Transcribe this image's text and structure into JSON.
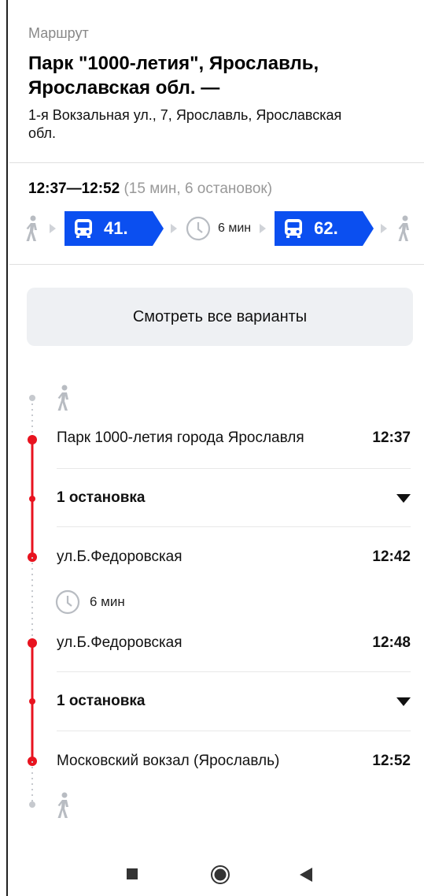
{
  "header": {
    "overline": "Маршрут",
    "title_line1": "Парк \"1000-летия\", Ярославль,",
    "title_line2": "Ярославская обл. —",
    "subtitle_line1": "1-я Вокзальная ул., 7, Ярославль, Ярославская",
    "subtitle_line2": "обл."
  },
  "summary": {
    "time_range": "12:37—12:52",
    "details": "(15 мин, 6 остановок)"
  },
  "route": {
    "bus1": "41.",
    "wait": "6 мин",
    "bus2": "62."
  },
  "all_variants_label": "Смотреть все варианты",
  "steps": {
    "stop1": {
      "name": "Парк 1000-летия города Ярославля",
      "time": "12:37"
    },
    "stops_count1": "1 остановка",
    "stop2": {
      "name": "ул.Б.Федоровская",
      "time": "12:42"
    },
    "wait": "6 мин",
    "stop3": {
      "name": "ул.Б.Федоровская",
      "time": "12:48"
    },
    "stops_count2": "1 остановка",
    "stop4": {
      "name": "Московский вокзал (Ярославль)",
      "time": "12:52"
    }
  },
  "colors": {
    "bus": "#0b4ff0",
    "line": "#e8131f",
    "muted": "#b8bcc2"
  }
}
